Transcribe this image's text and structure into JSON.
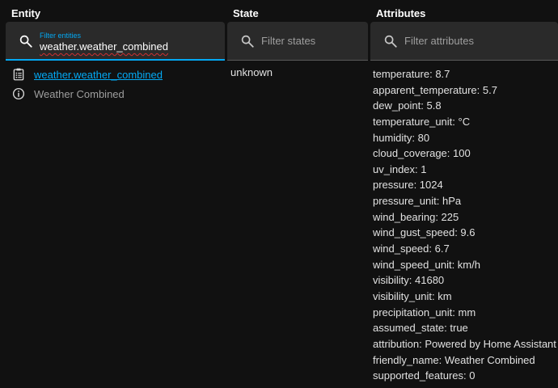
{
  "columns": {
    "entity": "Entity",
    "state": "State",
    "attributes": "Attributes"
  },
  "filters": {
    "entity": {
      "label": "Filter entities",
      "value": "weather.weather_combined"
    },
    "state": {
      "placeholder": "Filter states"
    },
    "attributes": {
      "placeholder": "Filter attributes"
    }
  },
  "entity": {
    "id": "weather.weather_combined",
    "friendly_name": "Weather Combined"
  },
  "state": "unknown",
  "attributes": [
    "temperature: 8.7",
    "apparent_temperature: 5.7",
    "dew_point: 5.8",
    "temperature_unit: °C",
    "humidity: 80",
    "cloud_coverage: 100",
    "uv_index: 1",
    "pressure: 1024",
    "pressure_unit: hPa",
    "wind_bearing: 225",
    "wind_gust_speed: 9.6",
    "wind_speed: 6.7",
    "wind_speed_unit: km/h",
    "visibility: 41680",
    "visibility_unit: km",
    "precipitation_unit: mm",
    "assumed_state: true",
    "attribution: Powered by Home Assistant",
    "friendly_name: Weather Combined",
    "supported_features: 0"
  ],
  "colors": {
    "accent": "#03a9f4",
    "background": "#111111",
    "field": "#2a2a2a"
  },
  "icons": {
    "search": "magnify-icon",
    "entity": "clipboard-list-icon",
    "info": "information-outline-icon"
  }
}
